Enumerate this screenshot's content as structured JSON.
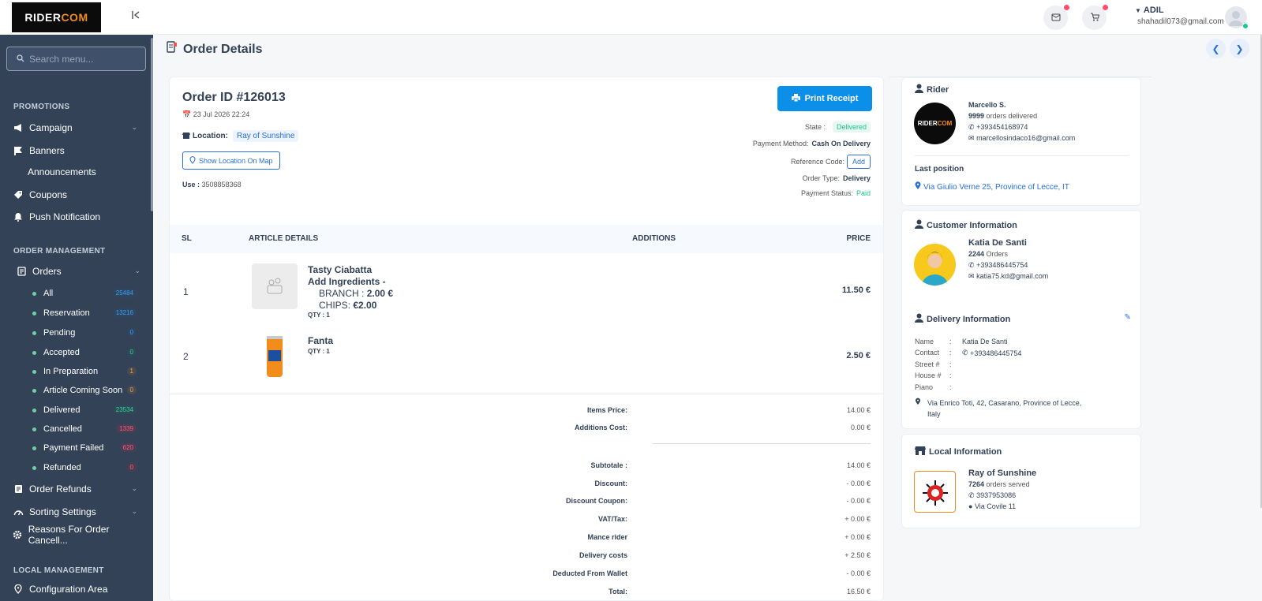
{
  "brand": {
    "logo_main": "RIDER",
    "logo_accent": "COM"
  },
  "sidebar": {
    "search_placeholder": "Search menu...",
    "sections": {
      "promotions": "PROMOTIONS",
      "order_management": "ORDER MANAGEMENT",
      "local_management": "LOCAL MANAGEMENT"
    },
    "promotions": {
      "campaign": "Campaign",
      "banners": "Banners",
      "announcements": "Announcements",
      "coupons": "Coupons",
      "push": "Push Notification"
    },
    "orders": {
      "label": "Orders"
    },
    "order_subitems": [
      {
        "label": "All",
        "count": "25484"
      },
      {
        "label": "Reservation",
        "count": "13216"
      },
      {
        "label": "Pending",
        "count": "0"
      },
      {
        "label": "Accepted",
        "count": "0"
      },
      {
        "label": "In Preparation",
        "count": "1"
      },
      {
        "label": "Article Coming Soon",
        "count": "0"
      },
      {
        "label": "Delivered",
        "count": "23534"
      },
      {
        "label": "Cancelled",
        "count": "1339"
      },
      {
        "label": "Payment Failed",
        "count": "620"
      },
      {
        "label": "Refunded",
        "count": "0"
      }
    ],
    "more": {
      "refunds": "Order Refunds",
      "sorting": "Sorting Settings",
      "reasons": "Reasons For Order Cancell..."
    },
    "local": {
      "config": "Configuration Area"
    }
  },
  "header": {
    "user_name": "ADIL",
    "user_email": "shahadil073@gmail.com"
  },
  "page": {
    "title": "Order Details"
  },
  "order": {
    "id": "Order ID #126013",
    "date": "23 Jul 2026 22:24",
    "location_label": "Location:",
    "location": "Ray of Sunshine",
    "map_button": "Show Location On Map",
    "use_label": "Use :",
    "use_value": "3508858368",
    "print_button": "Print Receipt",
    "state_label": "State :",
    "state": "Delivered",
    "payment_method_label": "Payment Method:",
    "payment_method": "Cash On Delivery",
    "reference_label": "Reference Code:",
    "reference_add": "Add",
    "order_type_label": "Order Type:",
    "order_type": "Delivery",
    "payment_status_label": "Payment Status:",
    "payment_status": "Paid"
  },
  "table": {
    "headers": {
      "sl": "SL",
      "article": "ARTICLE DETAILS",
      "additions": "ADDITIONS",
      "price": "PRICE"
    },
    "rows": [
      {
        "sl": "1",
        "name": "Tasty Ciabatta",
        "line2": "Add Ingredients -",
        "line3a": "BRANCH :",
        "line3b": "2.00 €",
        "line4a": "CHIPS:",
        "line4b": "€2.00",
        "qty": "QTY : 1",
        "price": "11.50 €"
      },
      {
        "sl": "2",
        "name": "Fanta",
        "qty": "QTY : 1",
        "price": "2.50 €"
      }
    ]
  },
  "summary": [
    {
      "label": "Items Price:",
      "value": "14.00 €"
    },
    {
      "label": "Additions Cost:",
      "value": "0.00 €"
    },
    {
      "label": "Subtotale :",
      "value": "14.00 €"
    },
    {
      "label": "Discount:",
      "value": "- 0.00 €"
    },
    {
      "label": "Discount Coupon:",
      "value": "- 0.00 €"
    },
    {
      "label": "VAT/Tax:",
      "value": "+ 0.00 €"
    },
    {
      "label": "Mance rider",
      "value": "+ 0.00 €"
    },
    {
      "label": "Delivery costs",
      "value": "+ 2.50 €"
    },
    {
      "label": "Deducted From Wallet",
      "value": "- 0.00 €"
    },
    {
      "label": "Total:",
      "value": "16.50 €"
    }
  ],
  "rider": {
    "title": "Rider",
    "name": "Marcello S.",
    "orders_count": "9999",
    "orders_label": "orders delivered",
    "phone": "+393454168974",
    "email": "marcellosindaco16@gmail.com",
    "last_position_label": "Last position",
    "last_position": "Via Giulio Verne 25, Province of Lecce, IT"
  },
  "customer": {
    "title": "Customer Information",
    "name": "Katia De Santi",
    "orders_count": "2244",
    "orders_label": "Orders",
    "phone": "+393486445754",
    "email": "katia75.kd@gmail.com"
  },
  "delivery": {
    "title": "Delivery Information",
    "name_label": "Name",
    "name": "Katia De Santi",
    "contact_label": "Contact",
    "contact": "+393486445754",
    "street_label": "Street #",
    "house_label": "House #",
    "piano_label": "Piano",
    "address_line1": "Via Enrico Toti, 42, Casarano, Province of Lecce,",
    "address_line2": "Italy"
  },
  "local": {
    "title": "Local Information",
    "name": "Ray of Sunshine",
    "orders_count": "7264",
    "orders_label": "orders served",
    "phone": "3937953086",
    "address": "Via Covile 11"
  }
}
